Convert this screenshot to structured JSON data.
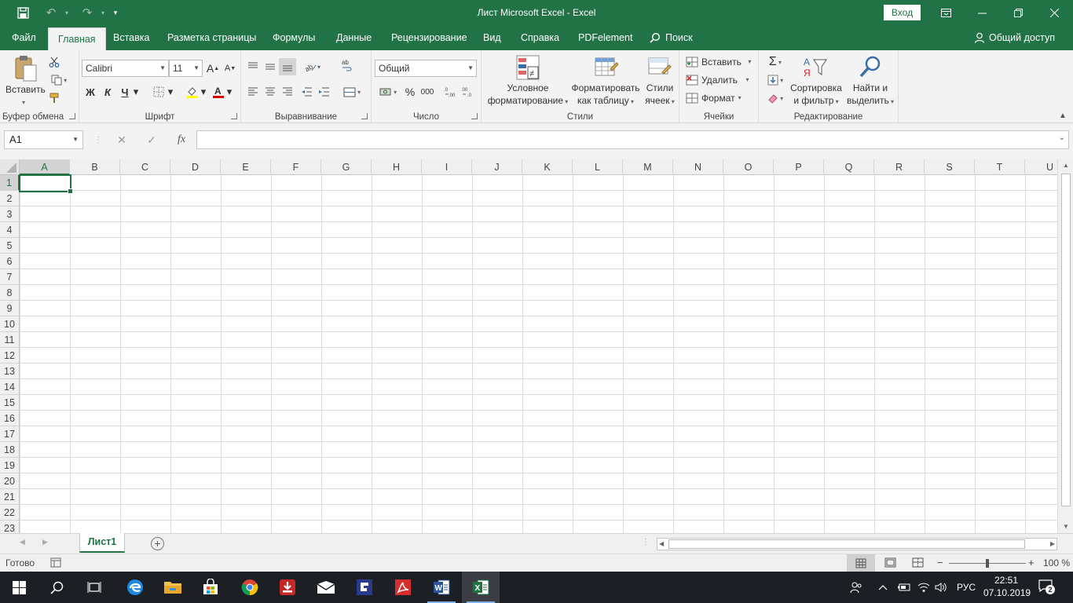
{
  "app": {
    "title": "Лист Microsoft Excel  -  Excel",
    "login_label": "Вход",
    "colors": {
      "accent": "#217346",
      "ribbon_bg": "#f3f3f3",
      "taskbar": "#1c1f24"
    }
  },
  "tabs": [
    {
      "label": "Файл"
    },
    {
      "label": "Главная"
    },
    {
      "label": "Вставка"
    },
    {
      "label": "Разметка страницы"
    },
    {
      "label": "Формулы"
    },
    {
      "label": "Данные"
    },
    {
      "label": "Рецензирование"
    },
    {
      "label": "Вид"
    },
    {
      "label": "Справка"
    },
    {
      "label": "PDFelement"
    },
    {
      "label": "Поиск"
    }
  ],
  "share_label": "Общий доступ",
  "ribbon": {
    "clipboard": {
      "paste_label": "Вставить",
      "group_label": "Буфер обмена"
    },
    "font": {
      "name": "Calibri",
      "size": "11",
      "bold": "Ж",
      "italic": "К",
      "underline": "Ч",
      "grow": "A",
      "shrink": "A",
      "group_label": "Шрифт"
    },
    "alignment": {
      "group_label": "Выравнивание"
    },
    "number": {
      "format": "Общий",
      "percent": "%",
      "thousands": "000",
      "group_label": "Число"
    },
    "styles": {
      "conditional_line1": "Условное",
      "conditional_line2": "форматирование",
      "table_line1": "Форматировать",
      "table_line2": "как таблицу",
      "cell_line1": "Стили",
      "cell_line2": "ячеек",
      "group_label": "Стили"
    },
    "cells": {
      "insert": "Вставить",
      "delete": "Удалить",
      "format": "Формат",
      "group_label": "Ячейки"
    },
    "editing": {
      "sort_line1": "Сортировка",
      "sort_line2": "и фильтр",
      "find_line1": "Найти и",
      "find_line2": "выделить",
      "group_label": "Редактирование"
    }
  },
  "formula_bar": {
    "name_box": "A1",
    "cancel": "✕",
    "enter": "✓",
    "fx": "fx",
    "value": ""
  },
  "grid": {
    "columns": [
      "A",
      "B",
      "C",
      "D",
      "E",
      "F",
      "G",
      "H",
      "I",
      "J",
      "K",
      "L",
      "M",
      "N",
      "O",
      "P",
      "Q",
      "R",
      "S",
      "T",
      "U"
    ],
    "rows": [
      "1",
      "2",
      "3",
      "4",
      "5",
      "6",
      "7",
      "8",
      "9",
      "10",
      "11",
      "12",
      "13",
      "14",
      "15",
      "16",
      "17",
      "18",
      "19",
      "20",
      "21",
      "22",
      "23"
    ],
    "selected_cell": "A1"
  },
  "sheets": [
    {
      "name": "Лист1",
      "active": true
    }
  ],
  "status": {
    "ready": "Готово",
    "zoom": "100 %",
    "zoom_minus": "−",
    "zoom_plus": "+"
  },
  "taskbar": {
    "apps": [
      "start-icon",
      "search-icon",
      "task-view-icon",
      "edge-icon",
      "file-explorer-icon",
      "store-icon",
      "chrome-icon",
      "downloader-icon",
      "mail-icon",
      "pdfelement-icon",
      "acrobat-icon",
      "word-icon",
      "excel-icon"
    ],
    "language": "РУС",
    "time": "22:51",
    "date": "07.10.2019",
    "notifications": "2"
  }
}
